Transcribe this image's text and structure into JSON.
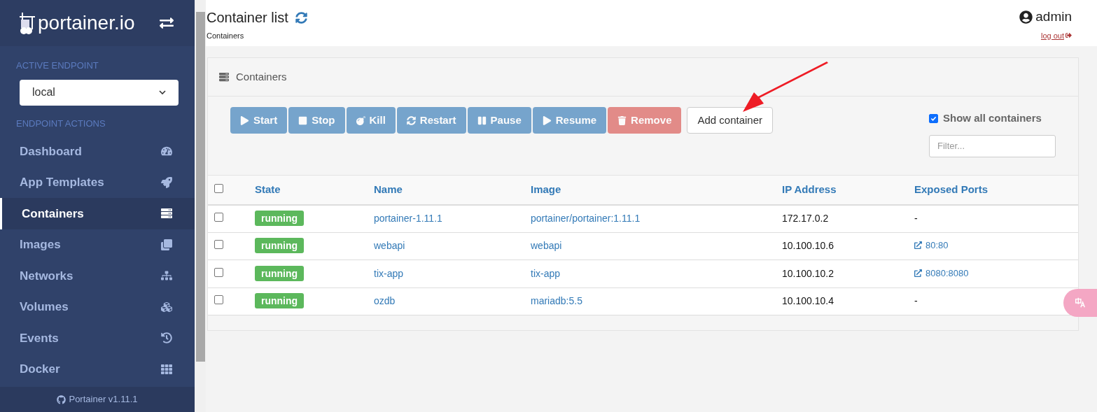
{
  "sidebar": {
    "logo": "portainer.io",
    "active_endpoint_label": "ACTIVE ENDPOINT",
    "endpoint": "local",
    "actions_label": "ENDPOINT ACTIONS",
    "items": [
      {
        "label": "Dashboard",
        "selected": false
      },
      {
        "label": "App Templates",
        "selected": false
      },
      {
        "label": "Containers",
        "selected": true
      },
      {
        "label": "Images",
        "selected": false
      },
      {
        "label": "Networks",
        "selected": false
      },
      {
        "label": "Volumes",
        "selected": false
      },
      {
        "label": "Events",
        "selected": false
      },
      {
        "label": "Docker",
        "selected": false
      }
    ],
    "footer": "Portainer v1.11.1"
  },
  "header": {
    "title": "Container list",
    "breadcrumb": "Containers",
    "user": "admin",
    "logout": "log out"
  },
  "panel": {
    "title": "Containers",
    "actions": [
      {
        "label": "Start",
        "kind": "primary",
        "disabled": true
      },
      {
        "label": "Stop",
        "kind": "primary",
        "disabled": true
      },
      {
        "label": "Kill",
        "kind": "primary",
        "disabled": true
      },
      {
        "label": "Restart",
        "kind": "primary",
        "disabled": true
      },
      {
        "label": "Pause",
        "kind": "primary",
        "disabled": true
      },
      {
        "label": "Resume",
        "kind": "primary",
        "disabled": true
      },
      {
        "label": "Remove",
        "kind": "danger",
        "disabled": true
      },
      {
        "label": "Add container",
        "kind": "default",
        "disabled": false
      }
    ],
    "show_all": {
      "label": "Show all containers",
      "checked": true
    },
    "filter": {
      "placeholder": "Filter..."
    },
    "table": {
      "select_all": {
        "checked": false
      },
      "columns": [
        "State",
        "Name",
        "Image",
        "IP Address",
        "Exposed Ports"
      ],
      "rows": [
        {
          "checked": false,
          "state": "running",
          "name": "portainer-1.11.1",
          "image": "portainer/portainer:1.11.1",
          "ip": "172.17.0.2",
          "ports": {
            "kind": "none",
            "text": "-"
          }
        },
        {
          "checked": false,
          "state": "running",
          "name": "webapi",
          "image": "webapi",
          "ip": "10.100.10.6",
          "ports": {
            "kind": "link",
            "text": "80:80"
          }
        },
        {
          "checked": false,
          "state": "running",
          "name": "tix-app",
          "image": "tix-app",
          "ip": "10.100.10.2",
          "ports": {
            "kind": "link",
            "text": "8080:8080"
          }
        },
        {
          "checked": false,
          "state": "running",
          "name": "ozdb",
          "image": "mariadb:5.5",
          "ip": "10.100.10.4",
          "ports": {
            "kind": "none",
            "text": "-"
          }
        }
      ]
    }
  }
}
